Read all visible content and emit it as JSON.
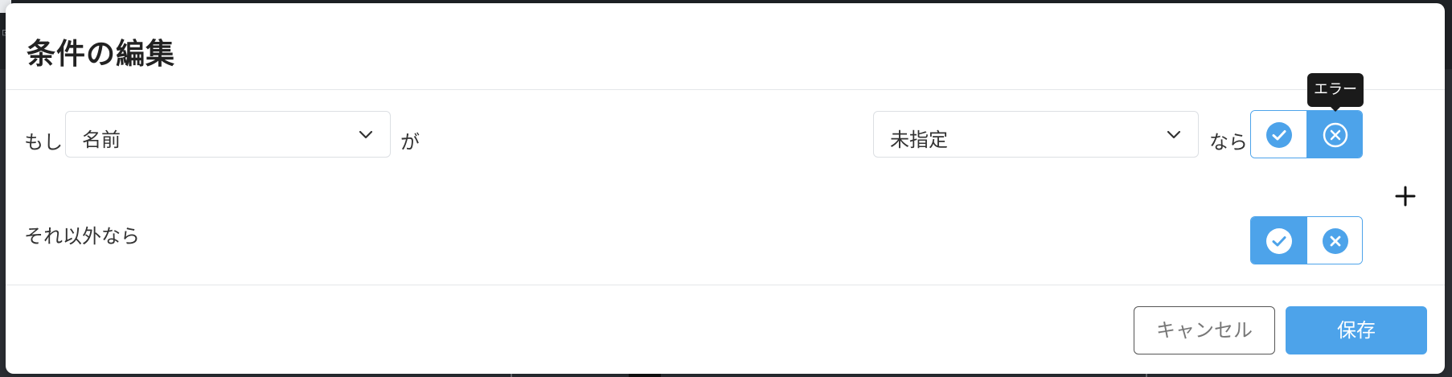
{
  "dialog": {
    "title": "条件の編集"
  },
  "condition": {
    "if_label": "もし",
    "field_select": {
      "value": "名前"
    },
    "ga_label": "が",
    "value_select": {
      "value": "未指定"
    },
    "then_label": "なら",
    "toggle": {
      "selected": "error"
    },
    "tooltip": "エラー"
  },
  "else_row": {
    "label": "それ以外なら",
    "toggle": {
      "selected": "success"
    }
  },
  "add_icon": "plus-icon",
  "footer": {
    "cancel_label": "キャンセル",
    "save_label": "保存"
  },
  "colors": {
    "accent": "#4da3ea",
    "tooltip_bg": "#1a1a1a"
  }
}
